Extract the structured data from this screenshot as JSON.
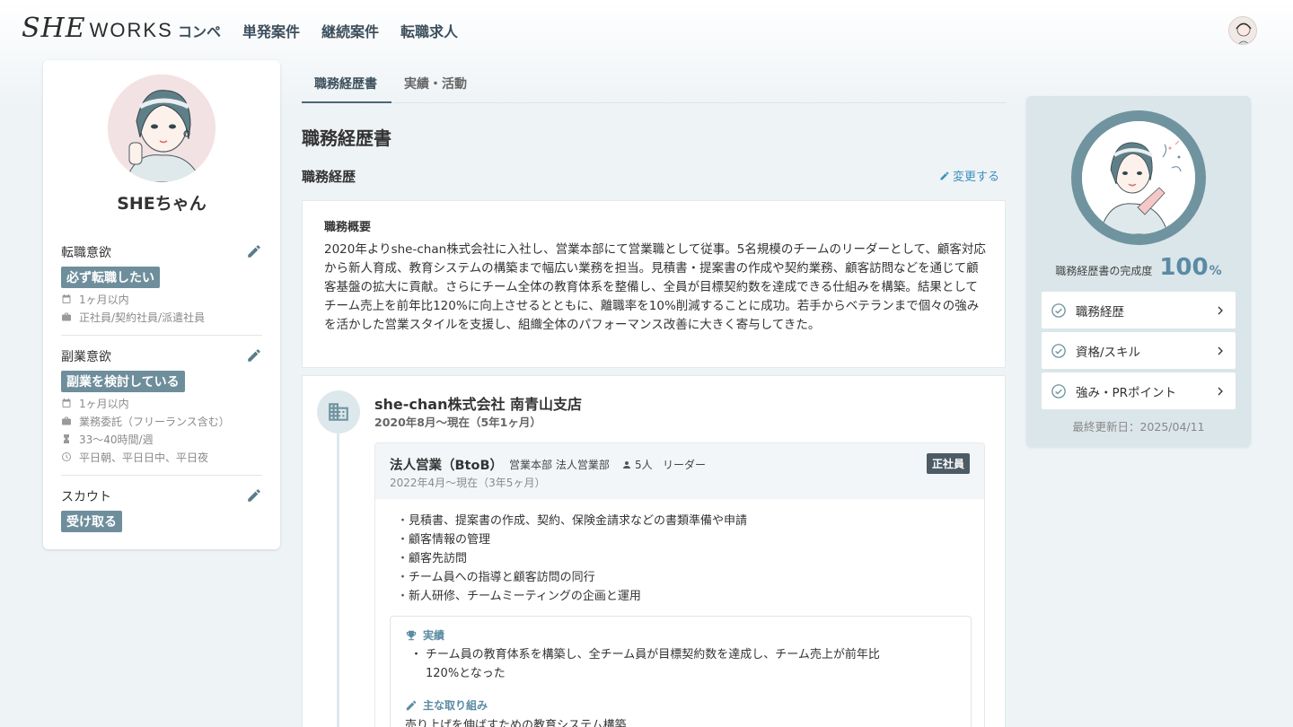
{
  "logo": {
    "she": "SHE",
    "works": "WORKS"
  },
  "nav": {
    "items": [
      "コンペ",
      "単発案件",
      "継続案件",
      "転職求人"
    ]
  },
  "profile": {
    "name": "SHEちゃん",
    "job_change": {
      "title": "転職意欲",
      "tag": "必ず転職したい",
      "timing": "1ヶ月以内",
      "employment": "正社員/契約社員/派遣社員"
    },
    "side_job": {
      "title": "副業意欲",
      "tag": "副業を検討している",
      "timing": "1ヶ月以内",
      "contract": "業務委託（フリーランス含む）",
      "hours": "33〜40時間/週",
      "times": "平日朝、平日日中、平日夜"
    },
    "scout": {
      "title": "スカウト",
      "tag": "受け取る"
    }
  },
  "tabs": [
    "職務経歴書",
    "実績・活動"
  ],
  "page_title": "職務経歴書",
  "career": {
    "subtitle": "職務経歴",
    "change_label": "変更する",
    "summary_title": "職務概要",
    "summary_text": "2020年よりshe-chan株式会社に入社し、営業本部にて営業職として従事。5名規模のチームのリーダーとして、顧客対応から新人育成、教育システムの構築まで幅広い業務を担当。見積書・提案書の作成や契約業務、顧客訪問などを通じて顧客基盤の拡大に貢献。さらにチーム全体の教育体系を整備し、全員が目標契約数を達成できる仕組みを構築。結果としてチーム売上を前年比120%に向上させるとともに、離職率を10%削減することに成功。若手からベテランまで個々の強みを活かした営業スタイルを支援し、組織全体のパフォーマンス改善に大きく寄与してきた。"
  },
  "company": {
    "name": "she-chan株式会社 南青山支店",
    "period": "2020年8月〜現在（5年1ヶ月）",
    "role": {
      "title": "法人営業（BtoB）",
      "dept": "営業本部 法人営業部",
      "people": "5人",
      "position": "リーダー",
      "period": "2022年4月〜現在（3年5ヶ月）",
      "badge": "正社員",
      "duties": [
        "見積書、提案書の作成、契約、保険金請求などの書類準備や申請",
        "顧客情報の管理",
        "顧客先訪問",
        "チーム員への指導と顧客訪問の同行",
        "新人研修、チームミーティングの企画と運用"
      ],
      "achievements_label": "実績",
      "achievement_line1": "チーム員の教育体系を構築し、全チーム員が目標契約数を達成し、チーム売上が前年比",
      "achievement_line2": "120%となった",
      "efforts_label": "主な取り組み",
      "effort_text": "売り上げを伸ばすための教育システム構築"
    }
  },
  "completion": {
    "label": "職務経歴書の完成度",
    "value": "100",
    "unit": "%",
    "percent": 100,
    "items": [
      "職務経歴",
      "資格/スキル",
      "強み・PRポイント"
    ],
    "updated": "最終更新日：2025/04/11"
  },
  "colors": {
    "accent": "#6f8e9c",
    "link": "#3d8fbd",
    "ring": "#6f949f"
  }
}
